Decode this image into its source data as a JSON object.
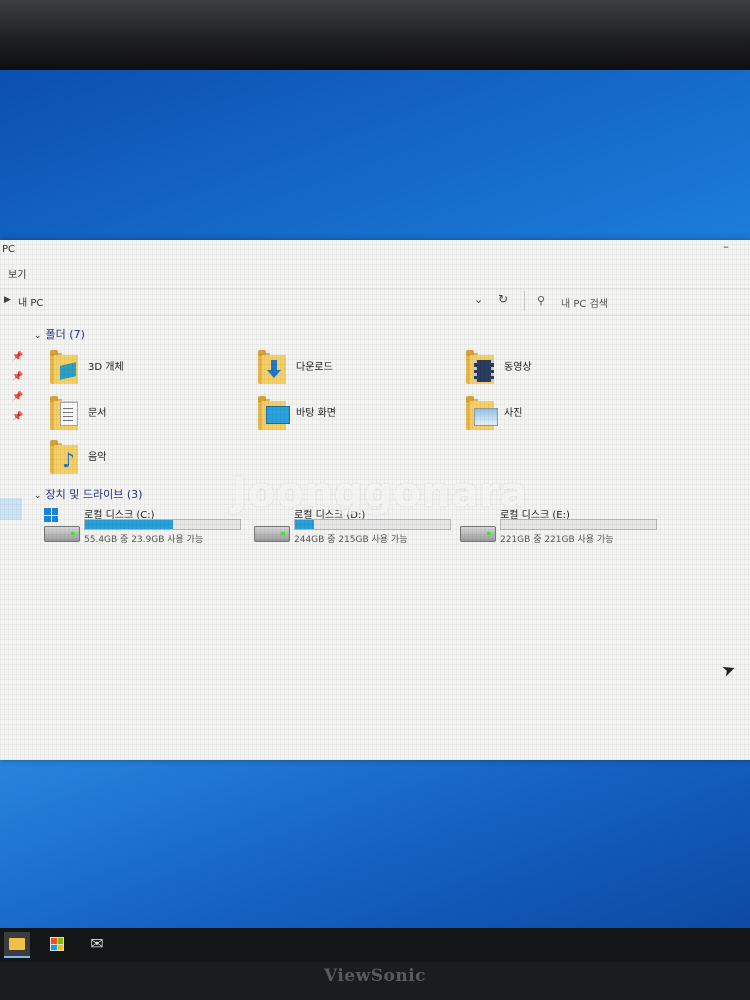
{
  "window": {
    "title": "PC",
    "ribbon_tab": "보기",
    "minimize_glyph": "–"
  },
  "address": {
    "path": "내 PC",
    "search_placeholder": "내 PC 검색"
  },
  "folders_section": {
    "header": "폴더 (7)",
    "items": [
      {
        "label": "3D 개체",
        "icon": "3d-objects-folder-icon"
      },
      {
        "label": "다운로드",
        "icon": "downloads-folder-icon"
      },
      {
        "label": "동영상",
        "icon": "videos-folder-icon"
      },
      {
        "label": "문서",
        "icon": "documents-folder-icon"
      },
      {
        "label": "바탕 화면",
        "icon": "desktop-folder-icon"
      },
      {
        "label": "사진",
        "icon": "pictures-folder-icon"
      },
      {
        "label": "음악",
        "icon": "music-folder-icon"
      }
    ]
  },
  "drives_section": {
    "header": "장치 및 드라이브 (3)",
    "drives": [
      {
        "name": "로컬 디스크 (C:)",
        "free_text": "55.4GB 중 23.9GB 사용 가능",
        "used_fraction": 0.57,
        "bar_color": "#26a0da"
      },
      {
        "name": "로컬 디스크 (D:)",
        "free_text": "244GB 중 215GB 사용 가능",
        "used_fraction": 0.12,
        "bar_color": "#26a0da"
      },
      {
        "name": "로컬 디스크 (E:)",
        "free_text": "221GB 중 221GB 사용 가능",
        "used_fraction": 0.0,
        "bar_color": "#26a0da"
      }
    ]
  },
  "watermark": "Joonggonara",
  "taskbar": {
    "icons": [
      "file-explorer-icon",
      "store-icon",
      "mail-icon"
    ]
  },
  "monitor_brand": "ViewSonic"
}
